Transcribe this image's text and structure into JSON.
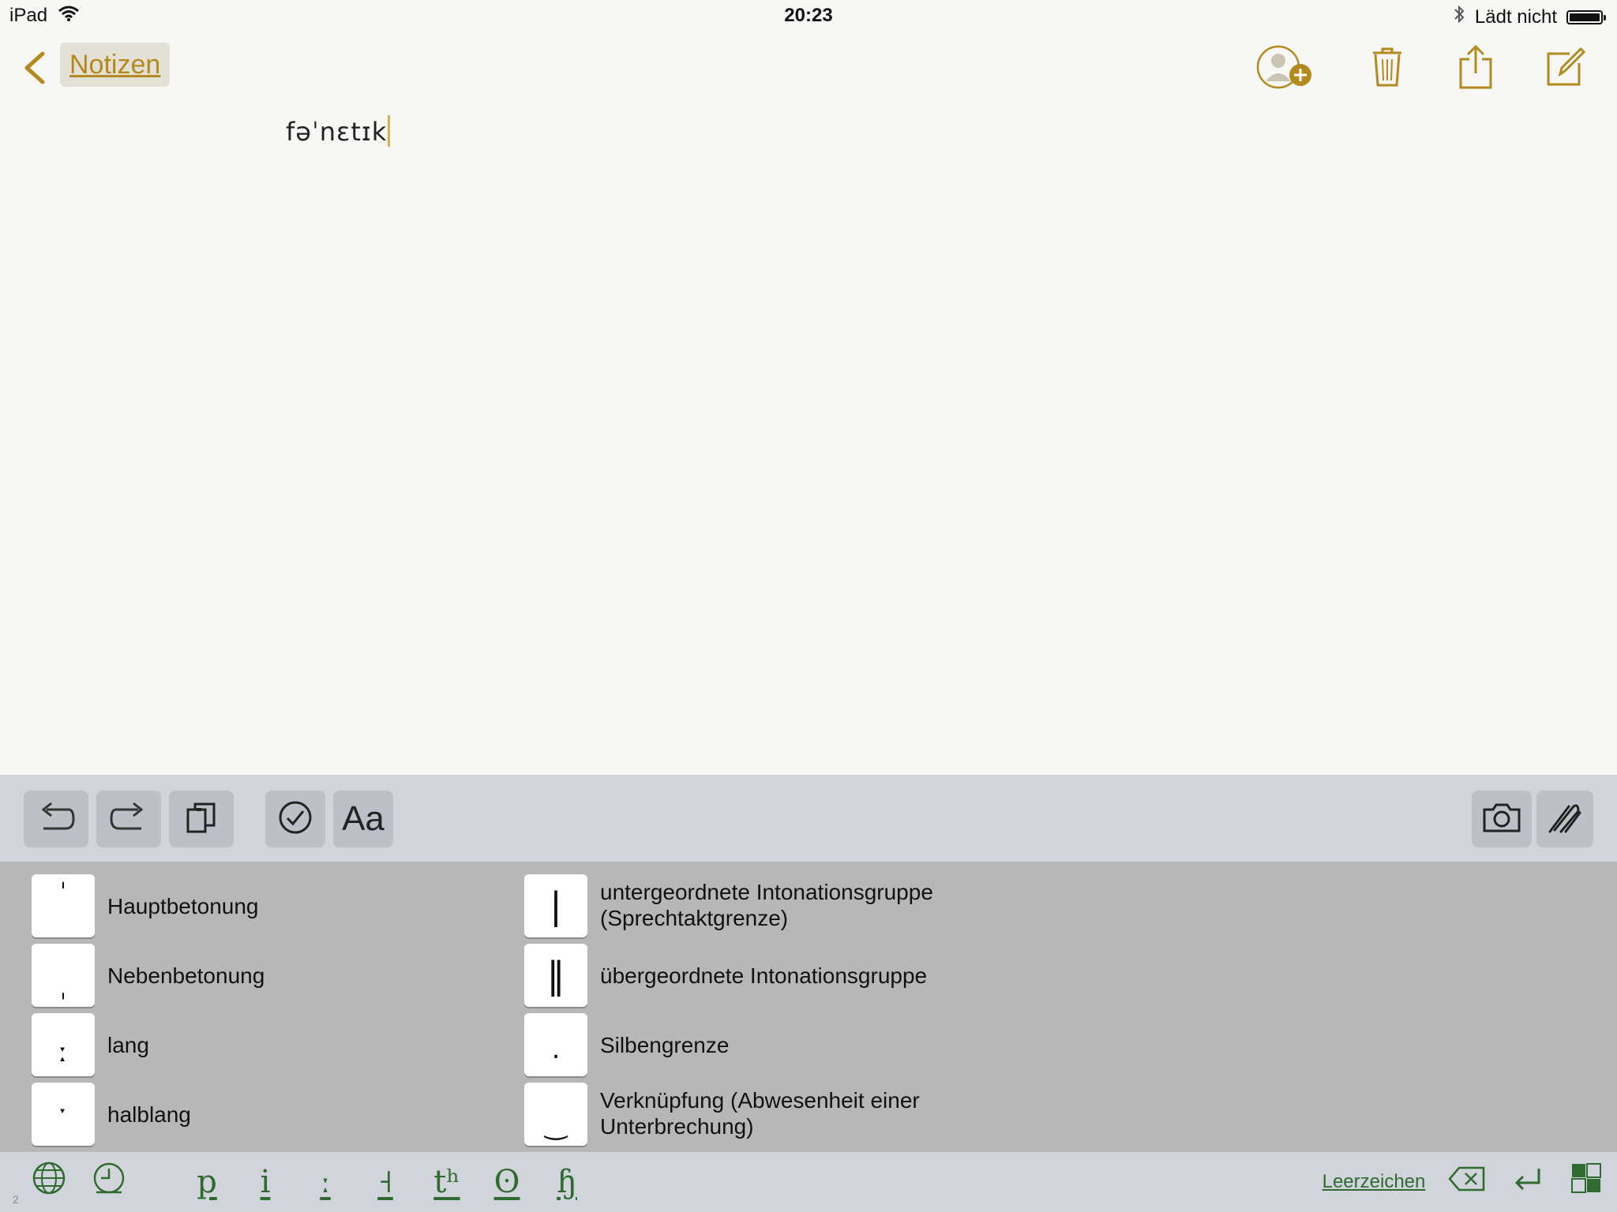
{
  "status_bar": {
    "device": "iPad",
    "time": "20:23",
    "charging": "Lädt nicht"
  },
  "nav": {
    "back_label": "Notizen"
  },
  "note": {
    "text": "fəˈnɛtɪk"
  },
  "toolbar": {
    "format_label": "Aa"
  },
  "ipa": {
    "left": [
      {
        "symbol": "ˈ",
        "label": "Hauptbetonung"
      },
      {
        "symbol": "ˌ",
        "label": "Nebenbetonung"
      },
      {
        "symbol": "ː",
        "label": "lang"
      },
      {
        "symbol": "ˑ",
        "label": "halblang"
      }
    ],
    "right": [
      {
        "symbol": "|",
        "label": "untergeordnete Intonationsgruppe (Sprechtaktgrenze)"
      },
      {
        "symbol": "‖",
        "label": "übergeordnete Intonationsgruppe"
      },
      {
        "symbol": ".",
        "label": "Silbengrenze"
      },
      {
        "symbol": "‿",
        "label": "Verknüpfung (Abwesenheit einer Unterbrechung)"
      }
    ]
  },
  "bottom_bar": {
    "categories": [
      "p",
      "i",
      "ː",
      "˧",
      "tʰ",
      "ʘ",
      "ɧ"
    ],
    "space_label": "Leerzeichen",
    "page_number": "2"
  },
  "colors": {
    "accent": "#b48a1f",
    "keyboard_text": "#2f6b2f"
  }
}
